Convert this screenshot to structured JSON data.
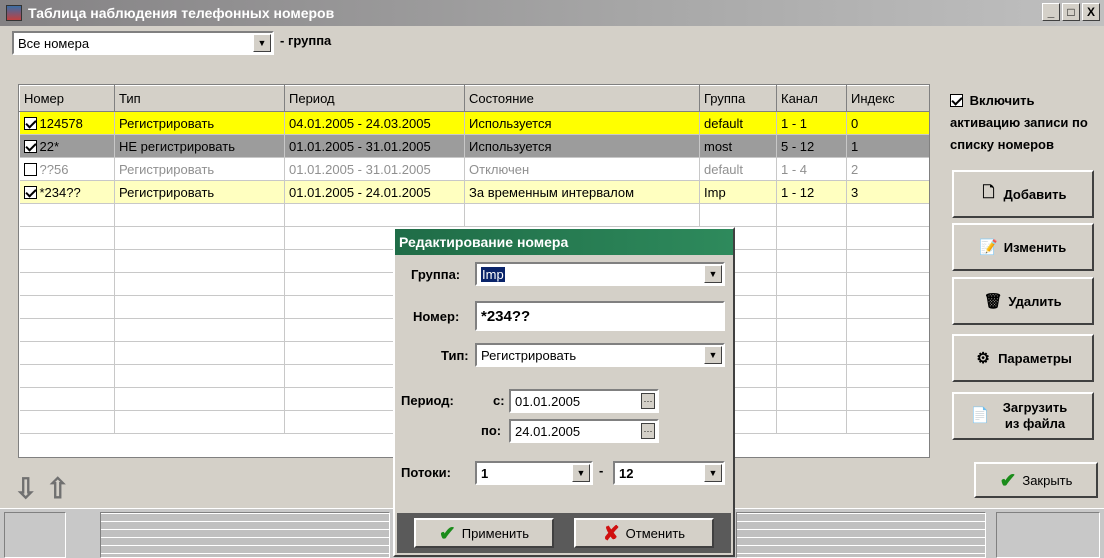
{
  "window": {
    "title": "Таблица наблюдения телефонных номеров",
    "btn_min": "_",
    "btn_max": "□",
    "btn_close": "X"
  },
  "toolbar": {
    "filter_value": "Все номера",
    "group_label": "- группа"
  },
  "grid": {
    "columns": [
      "Номер",
      "Тип",
      "Период",
      "Состояние",
      "Группа",
      "Канал",
      "Индекс"
    ],
    "rows": [
      {
        "checked": true,
        "number": "124578",
        "type": "Регистрировать",
        "period": "04.01.2005 - 24.03.2005",
        "state": "Используется",
        "group": "default",
        "channel": "1 - 1",
        "index": "0"
      },
      {
        "checked": true,
        "number": "22*",
        "type": "НЕ регистрировать",
        "period": "01.01.2005 - 31.01.2005",
        "state": "Используется",
        "group": "most",
        "channel": "5 - 12",
        "index": "1"
      },
      {
        "checked": false,
        "number": "??56",
        "type": "Регистрировать",
        "period": "01.01.2005 - 31.01.2005",
        "state": "Отключен",
        "group": "default",
        "channel": "1 - 4",
        "index": "2"
      },
      {
        "checked": true,
        "number": "*234??",
        "type": "Регистрировать",
        "period": "01.01.2005 - 24.01.2005",
        "state": "За временным интервалом",
        "group": "Imp",
        "channel": "1 - 12",
        "index": "3"
      }
    ],
    "row_colors": [
      "#ffff00",
      "#9c9c9c",
      "#ffffff",
      "#ffffc0"
    ]
  },
  "side": {
    "enable_text": "Включить активацию записи по списку номеров",
    "add": "Добавить",
    "edit": "Изменить",
    "delete": "Удалить",
    "params": "Параметры",
    "load": "Загрузить из файла"
  },
  "bottom": {
    "down_icon": "⇩",
    "up_icon": "⇧",
    "close": "Закрыть"
  },
  "dialog": {
    "title": "Редактирование номера",
    "group_label": "Группа:",
    "group_value": "Imp",
    "number_label": "Номер:",
    "number_value": "*234??",
    "type_label": "Тип:",
    "type_value": "Регистрировать",
    "period_label": "Период:",
    "from_label": "с:",
    "from_value": "01.01.2005",
    "to_label": "по:",
    "to_value": "24.01.2005",
    "streams_label": "Потоки:",
    "stream_from": "1",
    "stream_sep": "-",
    "stream_to": "12",
    "apply": "Применить",
    "cancel": "Отменить"
  },
  "colors": {
    "dialog_title": "#1f6c47",
    "apply_icon": "#1b8c1b",
    "cancel_icon": "#d01010"
  }
}
